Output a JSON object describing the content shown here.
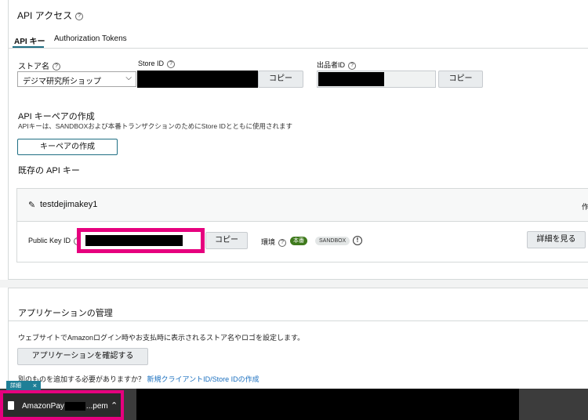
{
  "api_access": {
    "title": "API アクセス",
    "tabs": [
      "API キー",
      "Authorization Tokens"
    ],
    "store_name_label": "ストア名",
    "store_name_value": "デジマ研究所ショップ",
    "store_id_label": "Store ID",
    "copy_label": "コピー",
    "seller_id_label": "出品者ID"
  },
  "key_pair": {
    "title": "API キーペアの作成",
    "description": "APIキーは、SANDBOXおよび本番トランザクションのためにStore IDとともに使用されます",
    "create_button": "キーペアの作成",
    "existing_title": "既存の API キー"
  },
  "key_card": {
    "name": "testdejimakey1",
    "right_fragment": "作",
    "public_key_label": "Public Key ID",
    "copy_label": "コピー",
    "env_label": "環境",
    "prod_badge": "本番",
    "sandbox_badge": "SANDBOX",
    "details_button": "詳細を見る"
  },
  "app_management": {
    "title": "アプリケーションの管理",
    "description": "ウェブサイトでAmazonログイン時やお支払時に表示されるストア名やロゴを設定します。",
    "confirm_button": "アプリケーションを確認する",
    "prompt": "別のものを追加する必要がありますか？",
    "link": "新規クライアントID/Store IDの作成"
  },
  "download": {
    "tag_label": "詳細",
    "tag_close": "×",
    "file_prefix": "AmazonPay",
    "file_suffix": "...pem"
  },
  "colors": {
    "accent_pink": "#e6007e",
    "prod_green": "#3f7a1d",
    "link_blue": "#1a6fbf",
    "tooltip_teal": "#1f7f97"
  }
}
